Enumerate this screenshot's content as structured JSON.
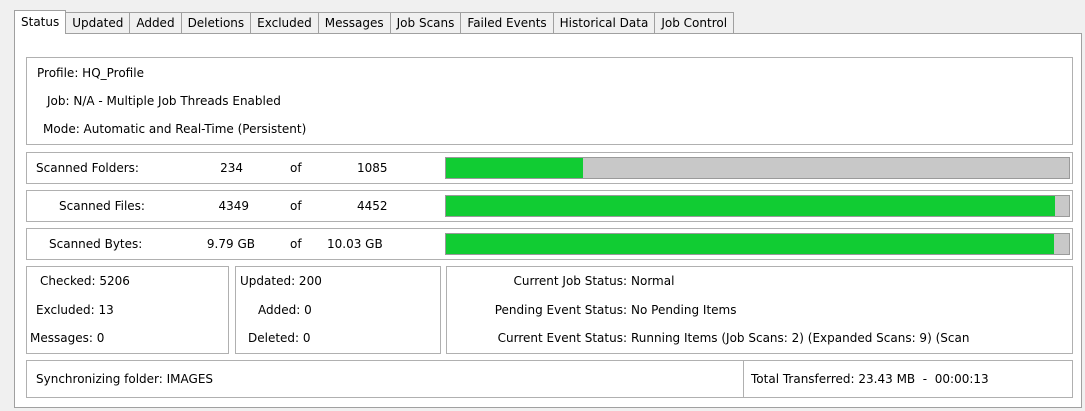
{
  "tabs": [
    {
      "label": "Status",
      "active": true
    },
    {
      "label": "Updated"
    },
    {
      "label": "Added"
    },
    {
      "label": "Deletions"
    },
    {
      "label": "Excluded"
    },
    {
      "label": "Messages"
    },
    {
      "label": "Job Scans"
    },
    {
      "label": "Failed Events"
    },
    {
      "label": "Historical Data"
    },
    {
      "label": "Job Control"
    }
  ],
  "profile": {
    "profile_line": "Profile: HQ_Profile",
    "job_line": "Job: N/A - Multiple Job Threads Enabled",
    "mode_line": "Mode: Automatic and Real-Time (Persistent)"
  },
  "scans": {
    "folders": {
      "label": "Scanned Folders:",
      "current": "234",
      "of": "of",
      "total": "1085",
      "progress": 0.22
    },
    "files": {
      "label": "Scanned Files:",
      "current": "4349",
      "of": "of",
      "total": "4452",
      "progress": 0.977
    },
    "bytes": {
      "label": "Scanned Bytes:",
      "current": "9.79 GB",
      "of": "of",
      "total": "10.03 GB",
      "progress": 0.976
    }
  },
  "counts": {
    "checked": "Checked: 5206",
    "excluded": "Excluded: 13",
    "messages": "Messages: 0",
    "updated": "Updated: 200",
    "added": "Added: 0",
    "deleted": "Deleted: 0"
  },
  "status": {
    "job_label": "Current Job Status:",
    "job_value": "Normal",
    "pending_label": "Pending Event Status:",
    "pending_value": "No Pending Items",
    "event_label": "Current Event Status:",
    "event_value": "Running Items (Job Scans: 2) (Expanded Scans: 9) (Scan"
  },
  "footer": {
    "sync": "Synchronizing folder: IMAGES",
    "transferred": "Total Transferred: 23.43 MB  -  00:00:13"
  },
  "colors": {
    "progress_fill": "#11cc33",
    "progress_track": "#c8c8c8"
  }
}
